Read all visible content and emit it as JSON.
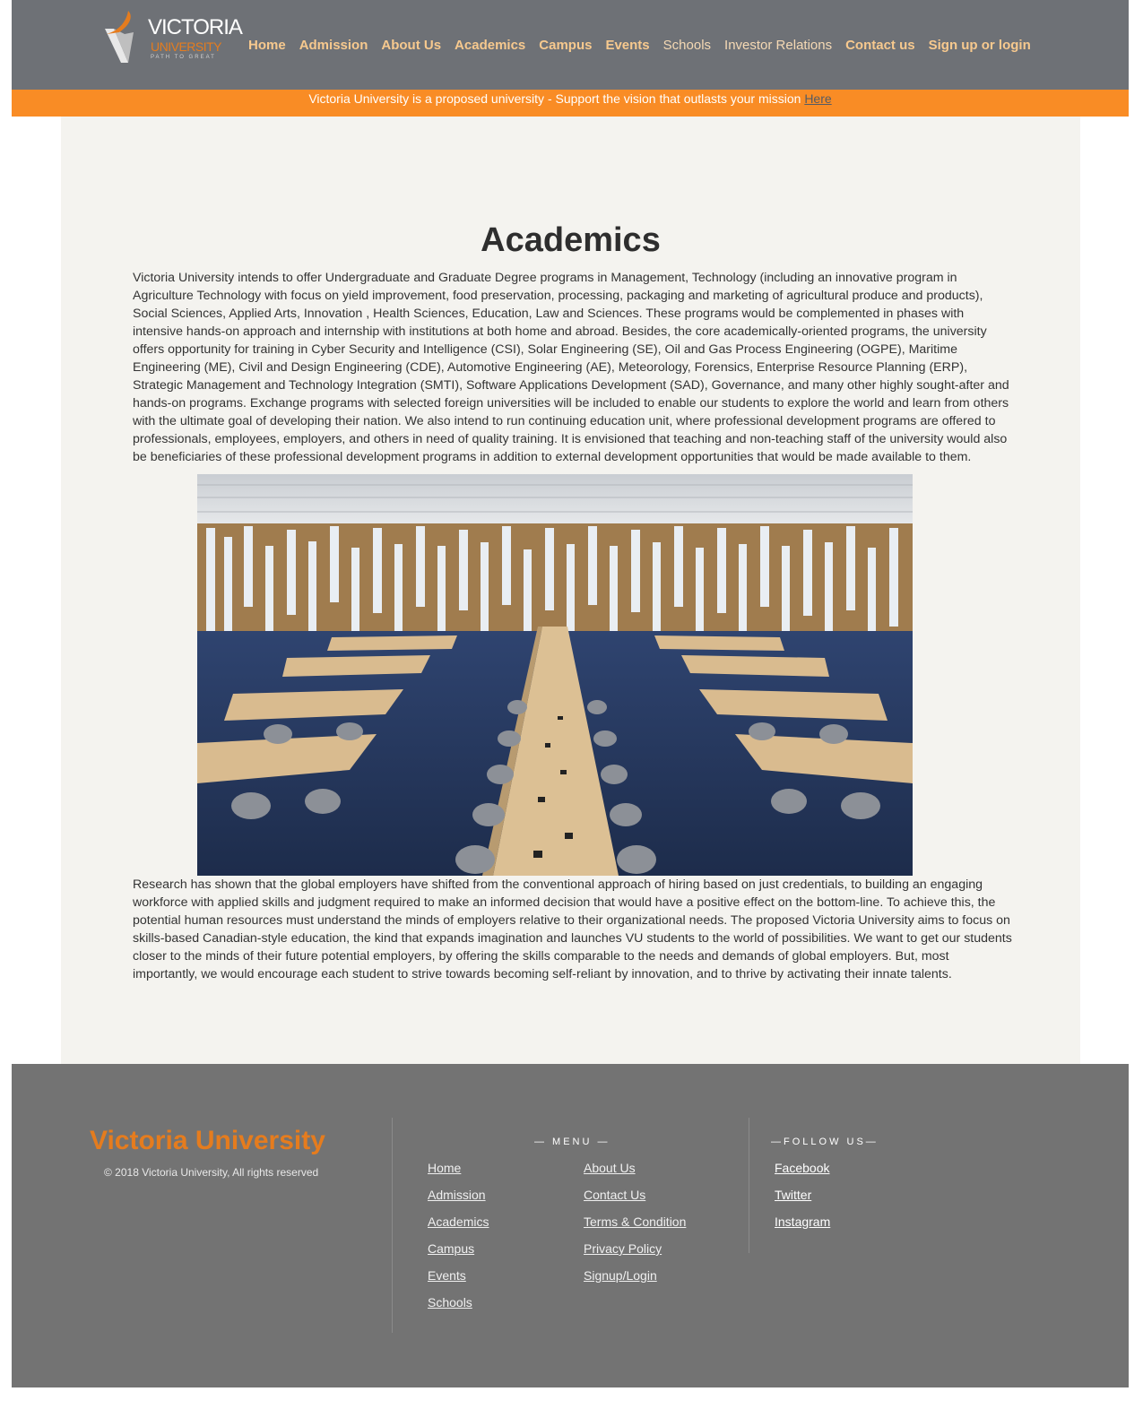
{
  "logo": {
    "name": "VICTORIA",
    "subtitle": "UNIVERSITY",
    "tagline": "PATH TO GREAT"
  },
  "nav": {
    "items": [
      {
        "label": "Home"
      },
      {
        "label": "Admission"
      },
      {
        "label": "About Us"
      },
      {
        "label": "Academics"
      },
      {
        "label": "Campus"
      },
      {
        "label": "Events"
      },
      {
        "label": "Schools"
      },
      {
        "label": "Investor Relations"
      },
      {
        "label": "Contact us"
      },
      {
        "label": "Sign up or login"
      }
    ]
  },
  "banner": {
    "text": "Victoria University is a proposed university - Support the vision that outlasts your mission ",
    "link": "Here"
  },
  "main": {
    "title": "Academics",
    "paragraph1": "Victoria University intends to offer Undergraduate and Graduate Degree programs in Management, Technology (including an innovative program in Agriculture Technology with focus on yield improvement, food preservation, processing, packaging and marketing of agricultural produce and products), Social Sciences, Applied Arts, Innovation , Health Sciences, Education, Law and Sciences. These programs would be complemented in phases with intensive hands-on approach and internship with institutions at both home and abroad. Besides, the core academically-oriented programs, the university offers opportunity for training in Cyber Security and Intelligence (CSI), Solar Engineering (SE), Oil and Gas Process Engineering (OGPE), Maritime Engineering (ME), Civil and Design Engineering (CDE), Automotive Engineering (AE), Meteorology, Forensics, Enterprise Resource Planning (ERP), Strategic Management and Technology Integration (SMTI), Software Applications Development (SAD), Governance, and many other highly sought-after and hands-on programs. Exchange programs with selected foreign universities will be included to enable our students to explore the world and learn from others with the ultimate goal of developing their nation. We also intend to run continuing education unit, where professional development programs are offered to professionals, employees, employers, and others in need of quality training. It is envisioned that teaching and non-teaching staff of the university would also be beneficiaries of these professional development programs in addition to external development opportunities that would be made available to them.",
    "paragraph2": "Research has shown that the global employers have shifted from the conventional approach of hiring based on just credentials, to building an engaging workforce with applied skills and judgment required to make an informed decision that would have a positive effect on the bottom-line. To achieve this, the potential human resources must understand the minds of employers relative to their organizational needs. The proposed Victoria University aims to focus on skills-based Canadian-style education, the kind that expands imagination and launches VU students to the world of possibilities. We want to get our students closer to the minds of their future potential employers, by offering the skills comparable to the needs and demands of global employers. But, most importantly, we would encourage each student to strive towards becoming self-reliant by innovation, and to thrive by activating their innate talents."
  },
  "footer": {
    "brand": "Victoria University",
    "copyright": "© 2018 Victoria University, All rights reserved",
    "menu_heading": "— MENU —",
    "follow_heading": "—FOLLOW US—",
    "menu_col1": [
      {
        "label": "Home"
      },
      {
        "label": "Admission"
      },
      {
        "label": "Academics"
      },
      {
        "label": "Campus"
      },
      {
        "label": "Events"
      },
      {
        "label": "Schools"
      }
    ],
    "menu_col2": [
      {
        "label": "About Us"
      },
      {
        "label": "Contact Us"
      },
      {
        "label": "Terms & Condition"
      },
      {
        "label": "Privacy Policy"
      },
      {
        "label": "Signup/Login"
      }
    ],
    "social": [
      {
        "label": "Facebook"
      },
      {
        "label": "Twitter"
      },
      {
        "label": "Instagram"
      }
    ]
  },
  "colors": {
    "header_bg": "#6e7176",
    "nav_text": "#f7c98e",
    "banner_bg": "#f98c25",
    "brand_orange": "#e57c1e",
    "content_bg": "#f4f3ef",
    "footer_bg": "#737373"
  }
}
